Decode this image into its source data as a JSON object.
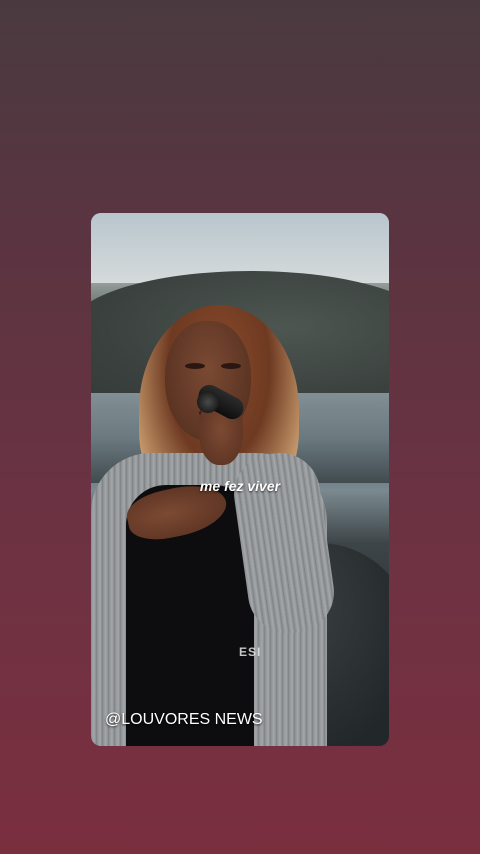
{
  "story": {
    "lyric": "me fez viver",
    "partial_text": "ESI",
    "watermark": "@LOUVORES NEWS"
  },
  "colors": {
    "background_top": "#4a3a40",
    "background_bottom": "#7a2f3f",
    "text": "#ffffff"
  }
}
